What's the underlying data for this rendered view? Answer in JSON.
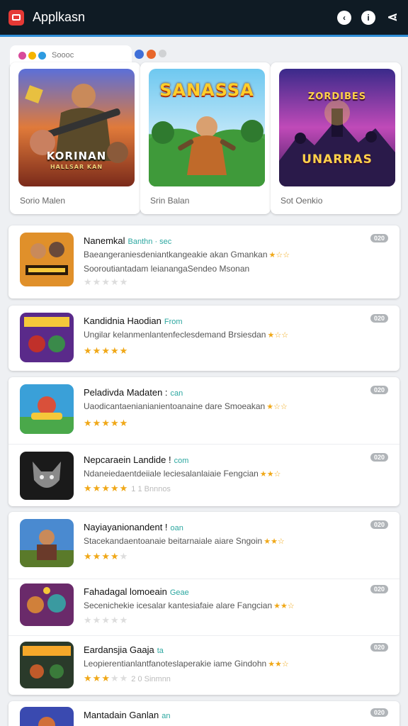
{
  "appbar": {
    "title": "Applkasn"
  },
  "featured": {
    "tab_text": "Soooc",
    "cards": [
      {
        "art_title": "KORINAN",
        "art_subtitle": "HALLSAR KAN",
        "label": "Sorio Malen"
      },
      {
        "art_title": "SANASSA",
        "art_subtitle": "",
        "label": "Srin Balan"
      },
      {
        "art_title": "ZORDIBES",
        "art_subtitle": "UNARRAS",
        "label": "Sot Oenkio"
      }
    ]
  },
  "list": [
    {
      "title": "Nanemkal",
      "tag": "Banthn · sec",
      "line1": "Baeangeraniesdeniantkangeakie akan Gmankan",
      "line1_stars": "★☆☆",
      "line2": "Sooroutiantadam leianangaSendeo Msonan",
      "rating": 0,
      "faint": "",
      "badge": "020"
    },
    {
      "title": "Kandidnia Haodian",
      "tag": "From",
      "line1": "Ungilar kelanmenlantenfeclesdemand Brsiesdan",
      "line1_stars": "★☆☆",
      "line2": "",
      "rating": 5,
      "faint": "",
      "badge": "020"
    },
    {
      "title": "Peladivda Madaten :",
      "tag": "can",
      "line1": "Uaodicantaenianianientoanaine dare Smoeakan",
      "line1_stars": "★☆☆",
      "line2": "",
      "rating": 5,
      "faint": "",
      "badge": "020"
    },
    {
      "title": "Nepcaraein Landide !",
      "tag": "com",
      "line1": "Ndaneiedaentdeiiale leciesalanlaiaie Fengcian",
      "line1_stars": "★★☆",
      "line2": "",
      "rating": 5,
      "faint": "1 1 Bnnnos",
      "badge": "020"
    },
    {
      "title": "Nayiayanionandent !",
      "tag": "oan",
      "line1": "Stacekandaentoanaie beitarnaiale aiare Sngoin",
      "line1_stars": "★★☆",
      "line2": "",
      "rating": 4,
      "faint": "",
      "badge": "020"
    },
    {
      "title": "Fahadagal lomoeain",
      "tag": "Geae",
      "line1": "Secenichekie icesalar kantesiafaie alare Fangcian",
      "line1_stars": "★★☆",
      "line2": "",
      "rating": 0,
      "faint": "",
      "badge": "020"
    },
    {
      "title": "Eardansjia Gaaja",
      "tag": "ta",
      "line1": "Leopierentianlantfanoteslaperakie iame Gindohn",
      "line1_stars": "★★☆",
      "line2": "",
      "rating": 3,
      "faint": "2 0 Sinmnn",
      "badge": "020"
    },
    {
      "title": "Mantadain Ganlan",
      "tag": "an",
      "line1": "",
      "line1_stars": "",
      "line2": "",
      "rating": 0,
      "faint": "",
      "badge": "020"
    }
  ]
}
